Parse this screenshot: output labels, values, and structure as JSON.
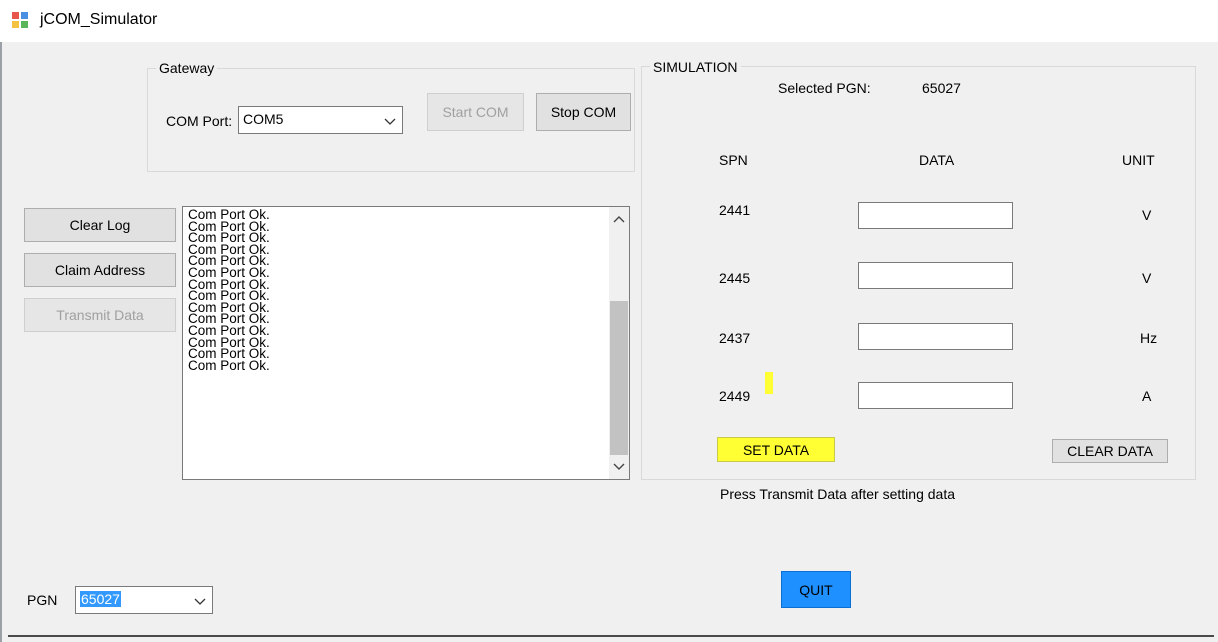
{
  "window": {
    "title": "jCOM_Simulator",
    "icon": "app-window-icon"
  },
  "gateway": {
    "title": "Gateway",
    "com_port_label": "COM Port:",
    "com_port_value": "COM5",
    "start_com_label": "Start COM",
    "stop_com_label": "Stop COM"
  },
  "left_buttons": {
    "clear_log": "Clear Log",
    "claim_address": "Claim Address",
    "transmit_data": "Transmit Data"
  },
  "log": {
    "lines": [
      "Com Port Ok.",
      "Com Port Ok.",
      "Com Port Ok.",
      "Com Port Ok.",
      "Com Port Ok.",
      "Com Port Ok.",
      "Com Port Ok.",
      "Com Port Ok.",
      "Com Port Ok.",
      "Com Port Ok.",
      "Com Port Ok.",
      "Com Port Ok.",
      "Com Port Ok.",
      "Com Port Ok."
    ]
  },
  "simulation": {
    "title": "SIMULATION",
    "selected_pgn_label": "Selected PGN:",
    "selected_pgn_value": "65027",
    "headers": {
      "spn": "SPN",
      "data": "DATA",
      "unit": "UNIT"
    },
    "rows": [
      {
        "spn": "2441",
        "data": "",
        "unit": "V"
      },
      {
        "spn": "2445",
        "data": "",
        "unit": "V"
      },
      {
        "spn": "2437",
        "data": "",
        "unit": "Hz"
      },
      {
        "spn": "2449",
        "data": "",
        "unit": "A"
      }
    ],
    "set_data_label": "SET DATA",
    "clear_data_label": "CLEAR DATA",
    "hint": "Press Transmit Data after setting data"
  },
  "pgn": {
    "label": "PGN",
    "value": "65027"
  },
  "quit_label": "QUIT",
  "colors": {
    "highlight": "#ffff33",
    "quit_button": "#1e90ff",
    "selection": "#3399ff"
  }
}
